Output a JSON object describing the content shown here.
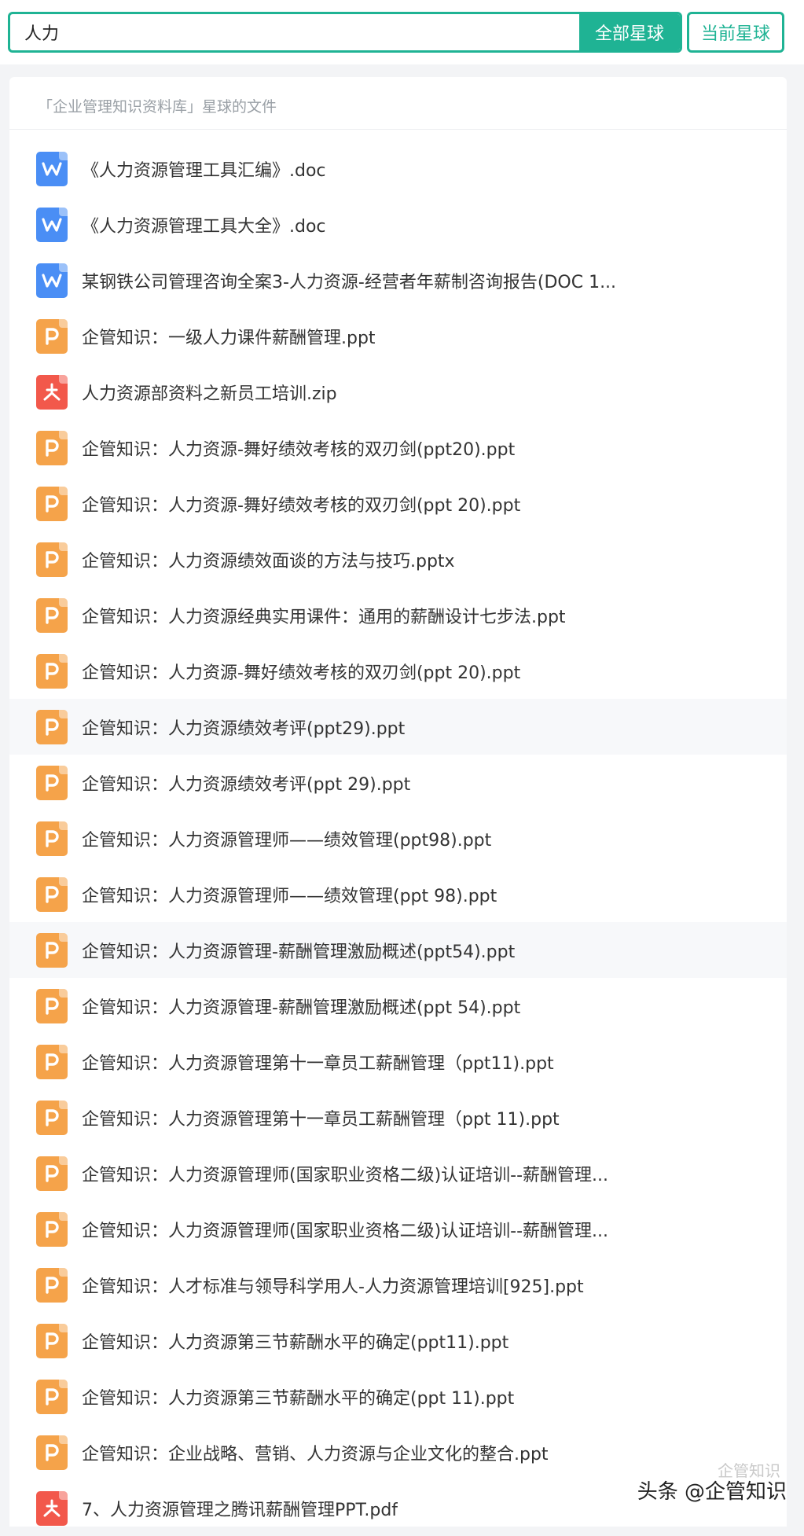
{
  "search": {
    "value": "人力",
    "all_label": "全部星球",
    "current_label": "当前星球"
  },
  "header": {
    "title": "「企业管理知识资料库」星球的文件"
  },
  "files": [
    {
      "type": "doc",
      "name": "《人力资源管理工具汇编》.doc"
    },
    {
      "type": "doc",
      "name": "《人力资源管理工具大全》.doc"
    },
    {
      "type": "doc",
      "name": "某钢铁公司管理咨询全案3-人力资源-经营者年薪制咨询报告(DOC 1..."
    },
    {
      "type": "ppt",
      "name": "企管知识：一级人力课件薪酬管理.ppt"
    },
    {
      "type": "pdf",
      "name": "人力资源部资料之新员工培训.zip"
    },
    {
      "type": "ppt",
      "name": "企管知识：人力资源-舞好绩效考核的双刃剑(ppt20).ppt"
    },
    {
      "type": "ppt",
      "name": "企管知识：人力资源-舞好绩效考核的双刃剑(ppt 20).ppt"
    },
    {
      "type": "ppt",
      "name": "企管知识：人力资源绩效面谈的方法与技巧.pptx"
    },
    {
      "type": "ppt",
      "name": "企管知识：人力资源经典实用课件：通用的薪酬设计七步法.ppt"
    },
    {
      "type": "ppt",
      "name": "企管知识：人力资源-舞好绩效考核的双刃剑(ppt 20).ppt"
    },
    {
      "type": "ppt",
      "name": "企管知识：人力资源绩效考评(ppt29).ppt"
    },
    {
      "type": "ppt",
      "name": "企管知识：人力资源绩效考评(ppt 29).ppt"
    },
    {
      "type": "ppt",
      "name": "企管知识：人力资源管理师——绩效管理(ppt98).ppt"
    },
    {
      "type": "ppt",
      "name": "企管知识：人力资源管理师——绩效管理(ppt 98).ppt"
    },
    {
      "type": "ppt",
      "name": "企管知识：人力资源管理-薪酬管理激励概述(ppt54).ppt"
    },
    {
      "type": "ppt",
      "name": "企管知识：人力资源管理-薪酬管理激励概述(ppt 54).ppt"
    },
    {
      "type": "ppt",
      "name": "企管知识：人力资源管理第十一章员工薪酬管理（ppt11).ppt"
    },
    {
      "type": "ppt",
      "name": "企管知识：人力资源管理第十一章员工薪酬管理（ppt 11).ppt"
    },
    {
      "type": "ppt",
      "name": "企管知识：人力资源管理师(国家职业资格二级)认证培训--薪酬管理..."
    },
    {
      "type": "ppt",
      "name": "企管知识：人力资源管理师(国家职业资格二级)认证培训--薪酬管理..."
    },
    {
      "type": "ppt",
      "name": "企管知识：人才标准与领导科学用人-人力资源管理培训[925].ppt"
    },
    {
      "type": "ppt",
      "name": "企管知识：人力资源第三节薪酬水平的确定(ppt11).ppt"
    },
    {
      "type": "ppt",
      "name": "企管知识：人力资源第三节薪酬水平的确定(ppt 11).ppt"
    },
    {
      "type": "ppt",
      "name": "企管知识：企业战略、营销、人力资源与企业文化的整合.ppt"
    },
    {
      "type": "pdf",
      "name": "7、人力资源管理之腾讯薪酬管理PPT.pdf"
    }
  ],
  "watermark": {
    "text": "头条 @企管知识",
    "faint": "企管知识"
  },
  "colors": {
    "accent": "#1fb394",
    "doc_icon": "#4a8ef5",
    "ppt_icon": "#f5a34a",
    "pdf_icon": "#f2584b"
  }
}
